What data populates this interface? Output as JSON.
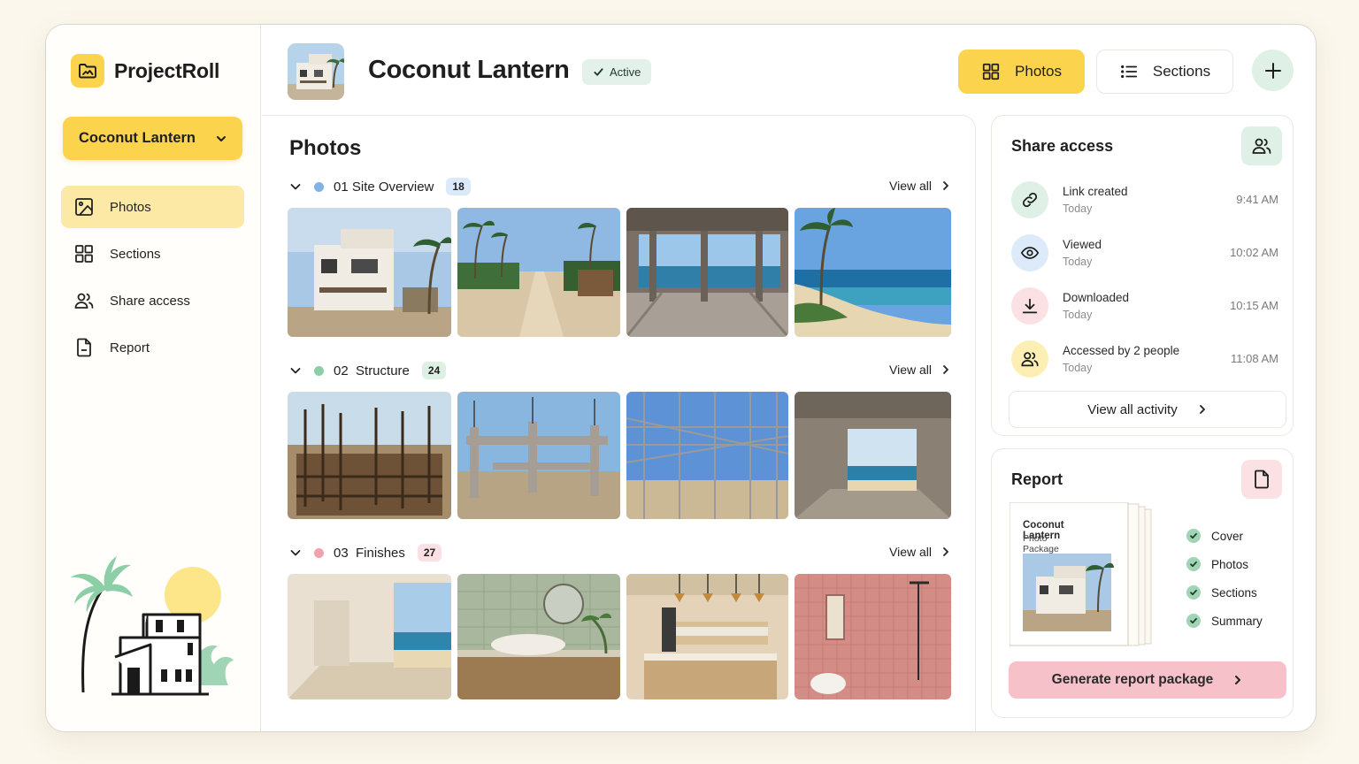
{
  "app": {
    "name": "ProjectRoll",
    "logo_icon": "folder-image-icon"
  },
  "project_selector": {
    "value": "Coconut Lantern"
  },
  "sidebar": {
    "items": [
      {
        "label": "Photos",
        "icon": "image-icon",
        "active": true
      },
      {
        "label": "Sections",
        "icon": "grid-icon",
        "active": false
      },
      {
        "label": "Share access",
        "icon": "users-icon",
        "active": false
      },
      {
        "label": "Report",
        "icon": "document-icon",
        "active": false
      }
    ]
  },
  "header": {
    "title": "Coconut Lantern",
    "status": "Active",
    "tabs": [
      {
        "label": "Photos",
        "active": true
      },
      {
        "label": "Sections",
        "active": false
      }
    ]
  },
  "photos": {
    "title": "Photos",
    "sections": [
      {
        "label": "01 Site Overview",
        "count": "18",
        "color": "#7fb2e5",
        "badge_bg": "#dbeafb",
        "view_all": "View all"
      },
      {
        "label": "02  Structure",
        "count": "24",
        "color": "#8ccfa6",
        "badge_bg": "#dcf1e3",
        "view_all": "View all"
      },
      {
        "label": "03  Finishes",
        "count": "27",
        "color": "#f2a2ae",
        "badge_bg": "#fbe0e4",
        "view_all": "View all"
      }
    ]
  },
  "share_access": {
    "title": "Share access",
    "activities": [
      {
        "label": "Link created",
        "sub": "Today",
        "time": "9:41 AM",
        "icon": "link-icon",
        "color": "#dff0e6"
      },
      {
        "label": "Viewed",
        "sub": "Today",
        "time": "10:02 AM",
        "icon": "eye-icon",
        "color": "#dceafa"
      },
      {
        "label": "Downloaded",
        "sub": "Today",
        "time": "10:15 AM",
        "icon": "download-icon",
        "color": "#fbe0e4"
      },
      {
        "label": "Accessed by 2 people",
        "sub": "Today",
        "time": "11:08 AM",
        "icon": "users-icon",
        "color": "#fdefb4"
      }
    ],
    "view_all": "View all activity"
  },
  "report": {
    "title": "Report",
    "preview_title": "Coconut Lantern",
    "preview_subtitle": "Photo Package",
    "checklist": [
      "Cover",
      "Photos",
      "Sections",
      "Summary"
    ],
    "generate": "Generate report package"
  },
  "colors": {
    "accent": "#fcd34d",
    "success": "#9fd4b4",
    "pink": "#f7c1c9"
  }
}
